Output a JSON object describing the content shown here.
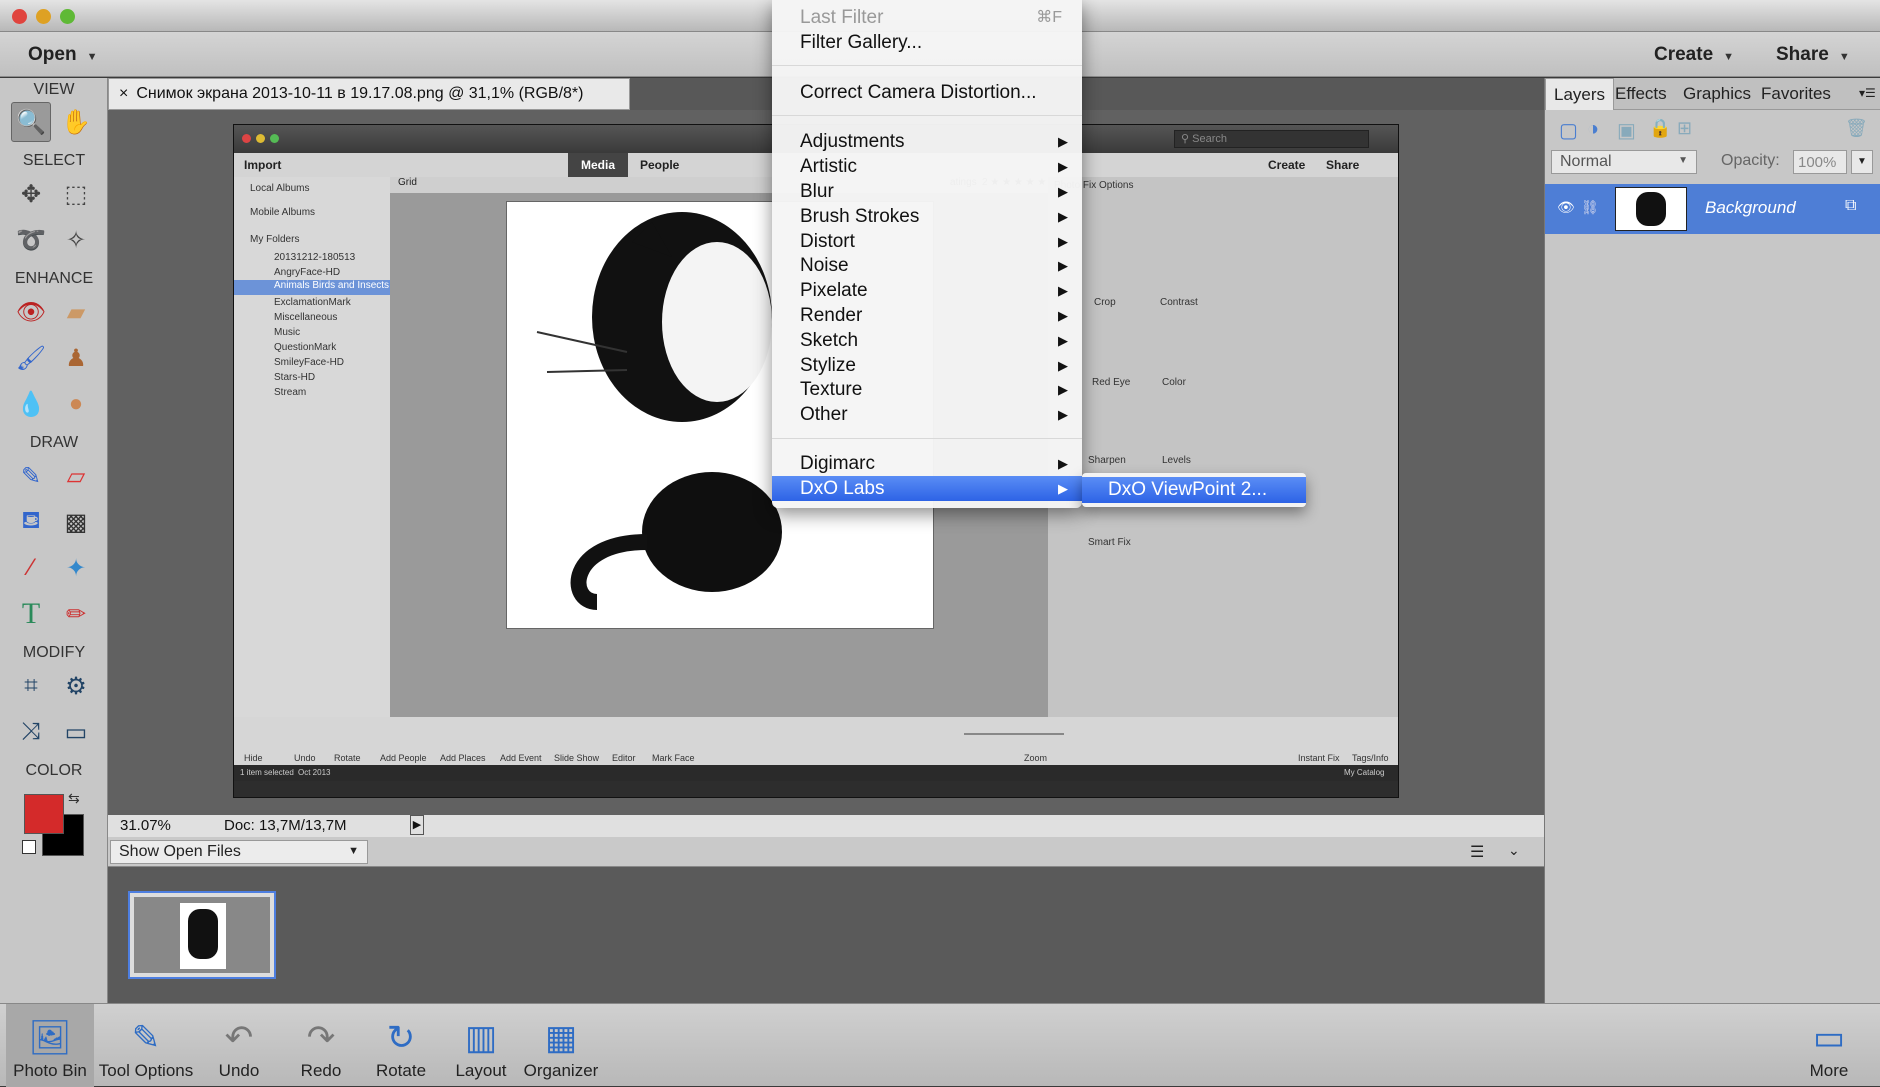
{
  "top": {
    "open_label": "Open",
    "create_label": "Create",
    "share_label": "Share"
  },
  "left": {
    "view": "VIEW",
    "select": "SELECT",
    "enhance": "ENHANCE",
    "draw": "DRAW",
    "modify": "MODIFY",
    "color": "COLOR"
  },
  "doc_tab": "Снимок экрана 2013-10-11 в 19.17.08.png @ 31,1% (RGB/8*)",
  "status": {
    "zoom": "31.07%",
    "doc": "Doc: 13,7M/13,7M"
  },
  "bin": {
    "select_value": "Show Open Files"
  },
  "right": {
    "tabs": [
      "Layers",
      "Effects",
      "Graphics",
      "Favorites"
    ],
    "blend_mode": "Normal",
    "opacity_label": "Opacity:",
    "opacity_value": "100%",
    "layer_name": "Background"
  },
  "bottom": [
    "Photo Bin",
    "Tool Options",
    "Undo",
    "Redo",
    "Rotate",
    "Layout",
    "Organizer",
    "More"
  ],
  "menu": {
    "last_filter": "Last Filter",
    "last_filter_shortcut": "⌘F",
    "items_top": [
      "Filter Gallery...",
      "Correct Camera Distortion..."
    ],
    "submenus": [
      "Adjustments",
      "Artistic",
      "Blur",
      "Brush Strokes",
      "Distort",
      "Noise",
      "Pixelate",
      "Render",
      "Sketch",
      "Stylize",
      "Texture",
      "Other"
    ],
    "plugins": [
      "Digimarc",
      "DxO Labs"
    ],
    "submenu_item": "DxO ViewPoint 2..."
  },
  "inner": {
    "import": "Import",
    "tabs": [
      "Media",
      "People"
    ],
    "search_placeholder": "Search",
    "create": "Create",
    "share": "Share",
    "grid": "Grid",
    "photo_fix": "Photo Fix Options",
    "albums": [
      "Local Albums",
      "Mobile Albums",
      "My Folders"
    ],
    "folders": [
      "20131212-180513",
      "AngryFace-HD",
      "Animals Birds and Insects",
      "ExclamationMark",
      "Miscellaneous",
      "Music",
      "QuestionMark",
      "SmileyFace-HD",
      "Stars-HD",
      "Stream"
    ],
    "fix_tools": [
      "Crop",
      "Contrast",
      "Red Eye",
      "Color",
      "Sharpen",
      "Levels",
      "Smart Fix"
    ],
    "bottom_tools": [
      "Hide",
      "Undo",
      "Rotate",
      "Add People",
      "Add Places",
      "Add Event",
      "Slide Show",
      "Editor",
      "Mark Face",
      "Zoom",
      "Instant Fix",
      "Tags/Info"
    ],
    "status_left": "1 item selected",
    "status_date": "Oct 2013",
    "status_right": "My Catalog",
    "ratings": "atings"
  },
  "colors": {
    "highlight": "#3a6ff0",
    "foreground": "#d42a2a",
    "background": "#000000"
  }
}
